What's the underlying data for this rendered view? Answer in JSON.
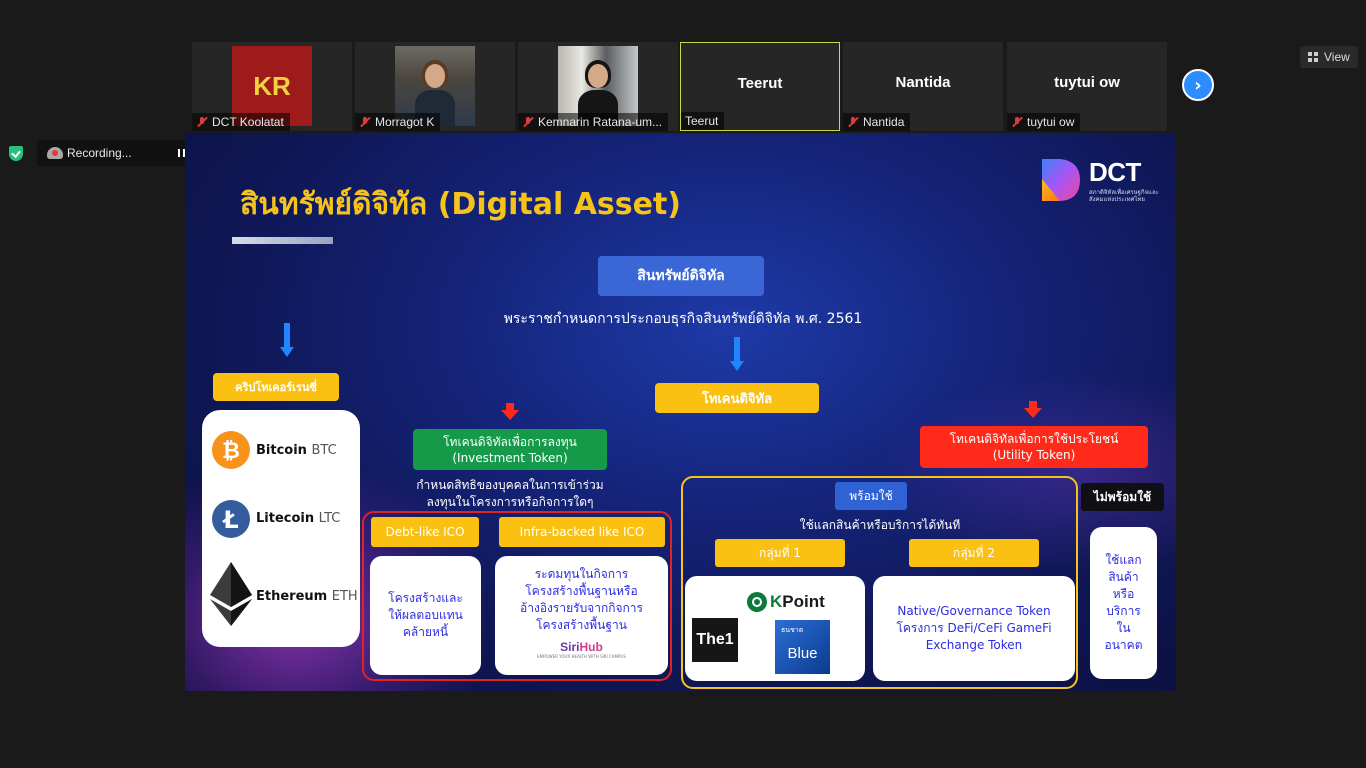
{
  "participants": [
    {
      "name": "DCT Koolatat",
      "initials": "KR",
      "muted": true
    },
    {
      "name": "Morragot K",
      "muted": true
    },
    {
      "name": "Kemnarin Ratana-um...",
      "muted": true
    },
    {
      "name": "Teerut",
      "display": "Teerut",
      "muted": false,
      "active": true
    },
    {
      "name": "Nantida",
      "display": "Nantida",
      "muted": true
    },
    {
      "name": "tuytui ow",
      "display": "tuytui ow",
      "muted": true
    }
  ],
  "toolbar": {
    "view_label": "View"
  },
  "recording": {
    "label": "Recording..."
  },
  "slide": {
    "title": "สินทรัพย์ดิจิทัล (Digital Asset)",
    "logo_text": "DCT",
    "logo_subtitle": "สภาดิจิทัลเพื่อเศรษฐกิจและสังคมแห่งประเทศไทย",
    "main_heading": "สินทรัพย์ดิจิทัล",
    "decree": "พระราชกำหนดการประกอบธุรกิจสินทรัพย์ดิจิทัล พ.ศ. 2561",
    "crypto_label": "คริปโทเคอร์เรนซี่",
    "cryptos": [
      {
        "name": "Bitcoin",
        "ticker": "BTC",
        "color": "#f7931a",
        "icon": "bitcoin-icon"
      },
      {
        "name": "Litecoin",
        "ticker": "LTC",
        "color": "#345d9d",
        "icon": "litecoin-icon"
      },
      {
        "name": "Ethereum",
        "ticker": "ETH",
        "color": "#3c3c3d",
        "icon": "ethereum-icon"
      }
    ],
    "token_label": "โทเคนดิจิทัล",
    "investment_token": {
      "line1": "โทเคนดิจิทัลเพื่อการลงทุน",
      "line2": "(Investment Token)"
    },
    "investment_desc": {
      "line1": "กำหนดสิทธิของบุคคลในการเข้าร่วม",
      "line2": "ลงทุนในโครงการหรือกิจการใดๆ"
    },
    "debt_label": "Debt-like ICO",
    "infra_label": "Infra-backed like ICO",
    "debt_card": {
      "line1": "โครงสร้างและ",
      "line2": "ให้ผลตอบแทน",
      "line3": "คล้ายหนี้"
    },
    "infra_card": {
      "line1": "ระดมทุนในกิจการ",
      "line2": "โครงสร้างพื้นฐานหรือ",
      "line3": "อ้างอิงรายรับจากกิจการ",
      "line4": "โครงสร้างพื้นฐาน"
    },
    "sirihub": {
      "prefix": "Siri",
      "suffix": "Hub",
      "tagline": "EMPOWER YOUR HEALTH WITH SIRI CAMPUS"
    },
    "utility_token": {
      "line1": "โทเคนดิจิทัลเพื่อการใช้ประโยชน์",
      "line2": "(Utility Token)"
    },
    "ready_label": "พร้อมใช้",
    "ready_desc": "ใช้แลกสินค้าหรือบริการได้ทันที",
    "group1_label": "กลุ่มที่ 1",
    "group2_label": "กลุ่มที่ 2",
    "group1_brands": {
      "the1": "The1",
      "kpoint_k": "K",
      "kpoint_rest": "Point",
      "blue_small": "ธนชาต",
      "blue": "Blue"
    },
    "group2_card": {
      "line1": "Native/Governance Token",
      "line2": "โครงการ DeFi/CeFi GameFi",
      "line3": "Exchange Token"
    },
    "notready_label": "ไม่พร้อมใช้",
    "notready_card": {
      "line1": "ใช้แลก",
      "line2": "สินค้า",
      "line3": "หรือ",
      "line4": "บริการ",
      "line5": "ใน",
      "line6": "อนาคต"
    }
  },
  "colors": {
    "accent_yellow": "#fbc112",
    "green": "#159a4a",
    "red": "#ff2a1a",
    "blue": "#3a66d6",
    "zoom_blue": "#2d8cff"
  }
}
